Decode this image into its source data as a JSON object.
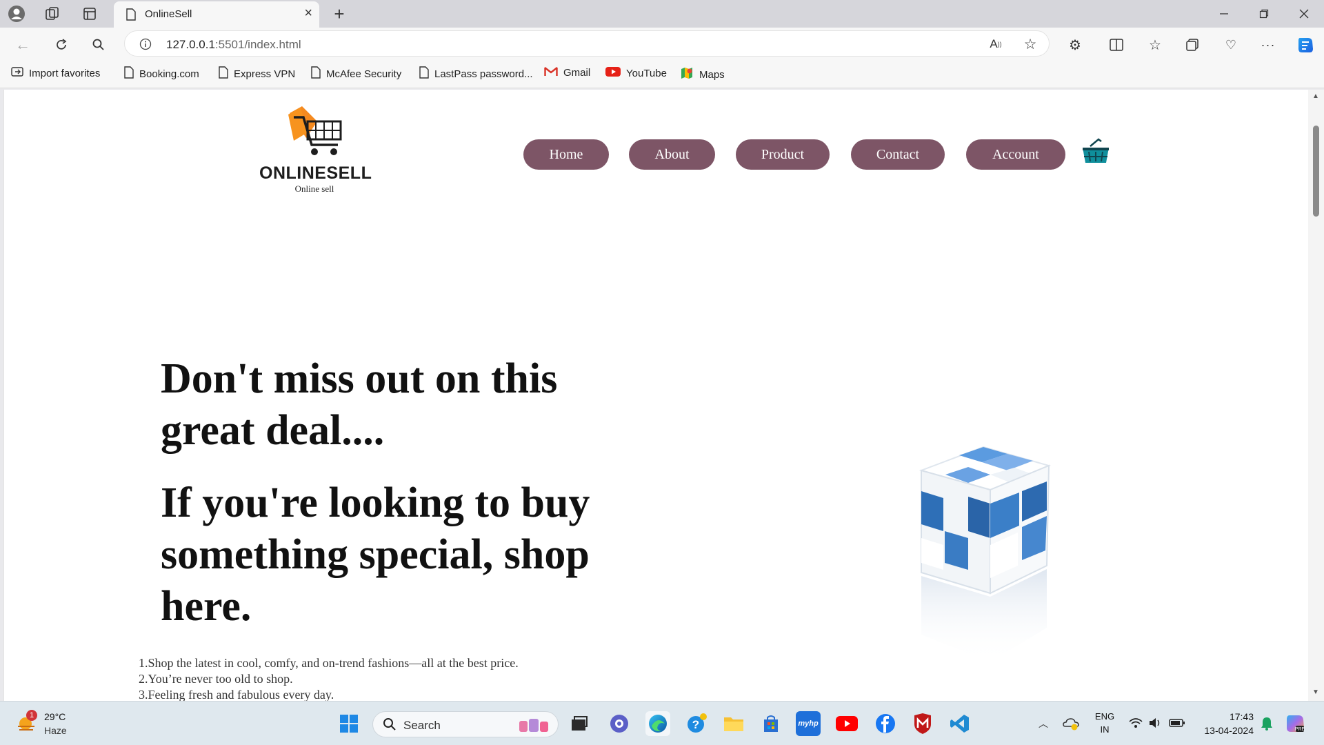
{
  "browser": {
    "tab_title": "OnlineSell",
    "url_host": "127.0.0.1",
    "url_rest": ":5501/index.html",
    "bookmarks": [
      {
        "label": "Import favorites",
        "icon": "import-icon"
      },
      {
        "label": "Booking.com",
        "icon": "page-icon"
      },
      {
        "label": "Express VPN",
        "icon": "page-icon"
      },
      {
        "label": "McAfee Security",
        "icon": "page-icon"
      },
      {
        "label": "LastPass password...",
        "icon": "page-icon"
      },
      {
        "label": "Gmail",
        "icon": "gmail-icon"
      },
      {
        "label": "YouTube",
        "icon": "youtube-icon"
      },
      {
        "label": "Maps",
        "icon": "maps-icon"
      }
    ]
  },
  "site": {
    "logo_text": "ONLINESELL",
    "logo_tagline": "Online sell",
    "nav": [
      {
        "label": "Home"
      },
      {
        "label": "About"
      },
      {
        "label": "Product"
      },
      {
        "label": "Contact"
      },
      {
        "label": "Account"
      }
    ],
    "cart_icon": "basket-icon",
    "hero_line1": "Don't miss out on this great deal....",
    "hero_line2": "If you're looking to buy something special, shop here.",
    "features": [
      "1.Shop the latest in cool, comfy, and on-trend fashions—all at the best price.",
      "2.You’re never too old to shop.",
      "3.Feeling fresh and fabulous every day."
    ],
    "accent_color": "#7d5566"
  },
  "taskbar": {
    "weather_temp": "29°C",
    "weather_desc": "Haze",
    "weather_badge": "1",
    "search_label": "Search",
    "lang_line1": "ENG",
    "lang_line2": "IN",
    "time": "17:43",
    "date": "13-04-2024"
  }
}
